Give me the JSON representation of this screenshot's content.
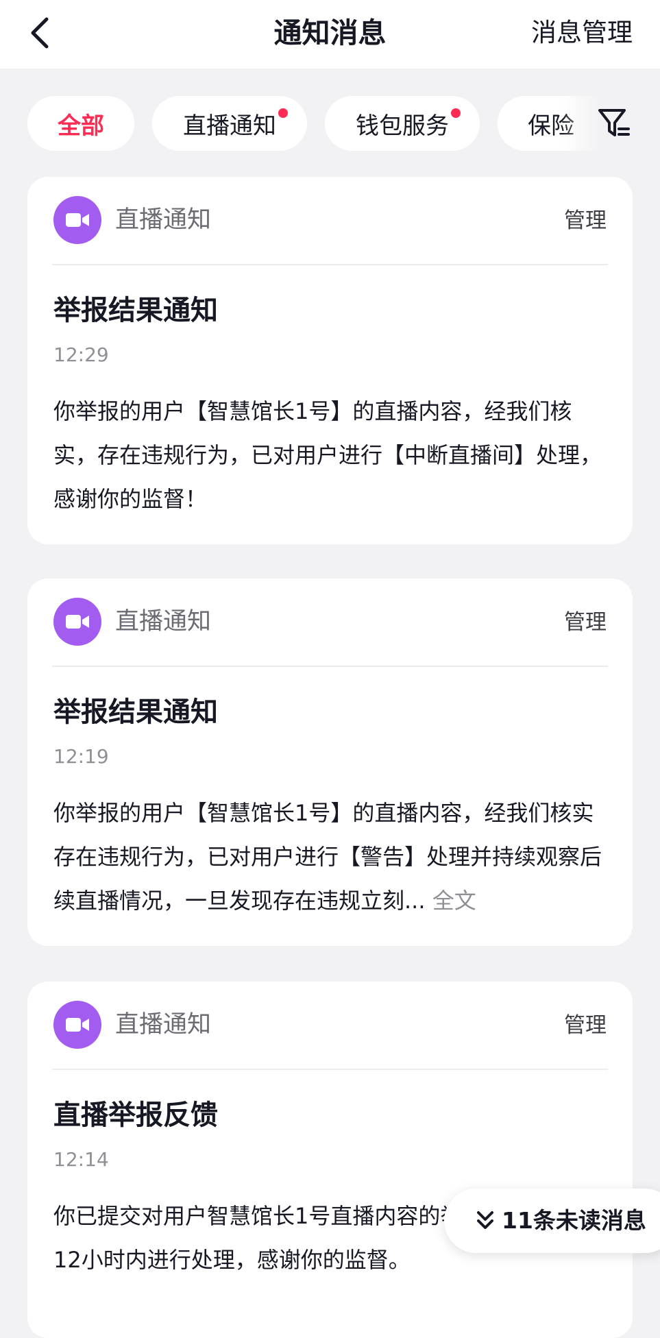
{
  "header": {
    "title": "通知消息",
    "manage_label": "消息管理"
  },
  "tabs": [
    {
      "label": "全部",
      "active": true,
      "unread_dot": false
    },
    {
      "label": "直播通知",
      "active": false,
      "unread_dot": true
    },
    {
      "label": "钱包服务",
      "active": false,
      "unread_dot": true
    },
    {
      "label": "保险",
      "active": false,
      "unread_dot": false
    }
  ],
  "cards": [
    {
      "category": "直播通知",
      "manage_label": "管理",
      "title": "举报结果通知",
      "time": "12:29",
      "body": "你举报的用户【智慧馆长1号】的直播内容，经我们核实，存在违规行为，已对用户进行【中断直播间】处理，感谢你的监督！"
    },
    {
      "category": "直播通知",
      "manage_label": "管理",
      "title": "举报结果通知",
      "time": "12:19",
      "body": "你举报的用户【智慧馆长1号】的直播内容，经我们核实存在违规行为，已对用户进行【警告】处理并持续观察后续直播情况，一旦发现存在违规立刻...",
      "more_label": "全文"
    },
    {
      "category": "直播通知",
      "manage_label": "管理",
      "title": "直播举报反馈",
      "time": "12:14",
      "body": "你已提交对用户智慧馆长1号直播内容的举报，我们会在12小时内进行处理，感谢你的监督。"
    }
  ],
  "unread_button": {
    "label": "11条未读消息"
  },
  "colors": {
    "accent": "#fe2c55",
    "category_icon": "#a35cf0",
    "page_bg": "#f2f2f4"
  },
  "icons": {
    "back": "chevron-left-icon",
    "filter": "filter-icon",
    "category": "video-camera-icon",
    "unread": "double-chevron-down-icon"
  }
}
